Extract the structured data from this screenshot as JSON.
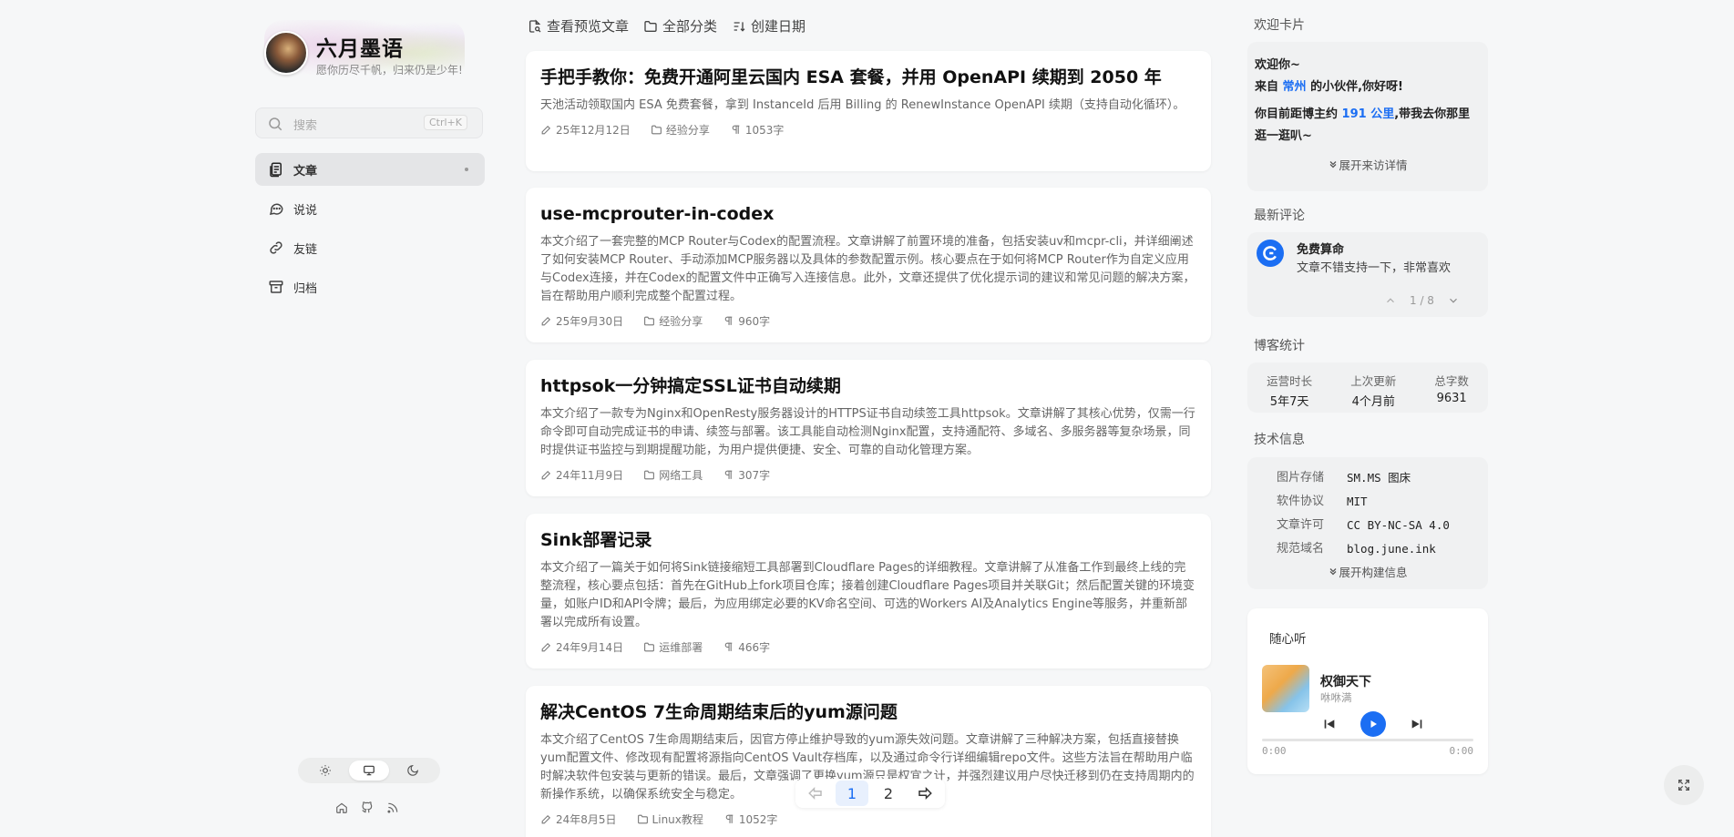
{
  "site": {
    "name": "六月墨语",
    "motto": "愿你历尽千帆，归来仍是少年!"
  },
  "search": {
    "placeholder": "搜索",
    "shortcut": "Ctrl+K"
  },
  "nav": [
    {
      "label": "文章",
      "icon": "article-icon",
      "active": true
    },
    {
      "label": "说说",
      "icon": "chat-icon"
    },
    {
      "label": "友链",
      "icon": "link-icon"
    },
    {
      "label": "归档",
      "icon": "archive-icon"
    }
  ],
  "toolbar": {
    "preview": "查看预览文章",
    "categories": "全部分类",
    "sort": "创建日期"
  },
  "posts": [
    {
      "title": "手把手教你：免费开通阿里云国内 ESA 套餐，并用 OpenAPI 续期到 2050 年",
      "summary": "天池活动领取国内 ESA 免费套餐，拿到 InstanceId 后用 Billing 的 RenewInstance OpenAPI 续期（支持自动化循环）。",
      "date": "25年12月12日",
      "category": "经验分享",
      "words": "1053字"
    },
    {
      "title": "use-mcprouter-in-codex",
      "summary": "本文介绍了一套完整的MCP Router与Codex的配置流程。文章讲解了前置环境的准备，包括安装uv和mcpr-cli，并详细阐述了如何安装MCP Router、手动添加MCP服务器以及具体的参数配置示例。核心要点在于如何将MCP Router作为自定义应用与Codex连接，并在Codex的配置文件中正确写入连接信息。此外，文章还提供了优化提示词的建议和常见问题的解决方案，旨在帮助用户顺利完成整个配置过程。",
      "date": "25年9月30日",
      "category": "经验分享",
      "words": "960字"
    },
    {
      "title": "httpsok一分钟搞定SSL证书自动续期",
      "summary": "本文介绍了一款专为Nginx和OpenResty服务器设计的HTTPS证书自动续签工具httpsok。文章讲解了其核心优势，仅需一行命令即可自动完成证书的申请、续签与部署。该工具能自动检测Nginx配置，支持通配符、多域名、多服务器等复杂场景，同时提供证书监控与到期提醒功能，为用户提供便捷、安全、可靠的自动化管理方案。",
      "date": "24年11月9日",
      "category": "网络工具",
      "words": "307字"
    },
    {
      "title": "Sink部署记录",
      "summary": "本文介绍了一篇关于如何将Sink链接缩短工具部署到Cloudflare Pages的详细教程。文章讲解了从准备工作到最终上线的完整流程，核心要点包括：首先在GitHub上fork项目仓库；接着创建Cloudflare Pages项目并关联Git；然后配置关键的环境变量，如账户ID和API令牌；最后，为应用绑定必要的KV命名空间、可选的Workers AI及Analytics Engine等服务，并重新部署以完成所有设置。",
      "date": "24年9月14日",
      "category": "运维部署",
      "words": "466字"
    },
    {
      "title": "解决CentOS 7生命周期结束后的yum源问题",
      "summary": "本文介绍了CentOS 7生命周期结束后，因官方停止维护导致的yum源失效问题。文章讲解了三种解决方案，包括直接替换yum配置文件、修改现有配置将源指向CentOS Vault存档库，以及通过命令行详细编辑repo文件。这些方法旨在帮助用户临时解决软件包安装与更新的错误。最后，文章强调了更换yum源只是权宜之计，并强烈建议用户尽快迁移到仍在支持周期内的新操作系统，以确保系统安全与稳定。",
      "date": "24年8月5日",
      "category": "Linux教程",
      "words": "1052字"
    }
  ],
  "pager": {
    "pages": [
      "1",
      "2"
    ],
    "current": "1"
  },
  "sidebar": {
    "welcome": {
      "title": "欢迎卡片",
      "greeting": "欢迎你~",
      "from_prefix": "来自",
      "city": "常州",
      "from_suffix": "的小伙伴,你好呀!",
      "distance_prefix": "你目前距博主约",
      "distance": "191 公里",
      "distance_suffix": ",带我去你那里逛一逛叭~",
      "expand": "展开来访详情"
    },
    "comments": {
      "title": "最新评论",
      "author": "免费算命",
      "text": "文章不错支持一下，非常喜欢",
      "counter": "1 / 8"
    },
    "stats": {
      "title": "博客统计",
      "items": [
        {
          "label": "运营时长",
          "value": "5年7天"
        },
        {
          "label": "上次更新",
          "value": "4个月前"
        },
        {
          "label": "总字数",
          "value": "9631"
        }
      ]
    },
    "tech": {
      "title": "技术信息",
      "rows": [
        {
          "key": "图片存储",
          "value": "SM.MS 图床"
        },
        {
          "key": "软件协议",
          "value": "MIT"
        },
        {
          "key": "文章许可",
          "value": "CC BY-NC-SA 4.0"
        },
        {
          "key": "规范域名",
          "value": "blog.june.ink"
        }
      ],
      "expand": "展开构建信息"
    },
    "music": {
      "title": "随心听",
      "song": "权御天下",
      "artist": "咻咻满",
      "current_time": "0:00",
      "duration": "0:00"
    }
  },
  "colors": {
    "accent": "#1b6ef3",
    "background": "#f6f7f8",
    "card": "#ffffff"
  }
}
